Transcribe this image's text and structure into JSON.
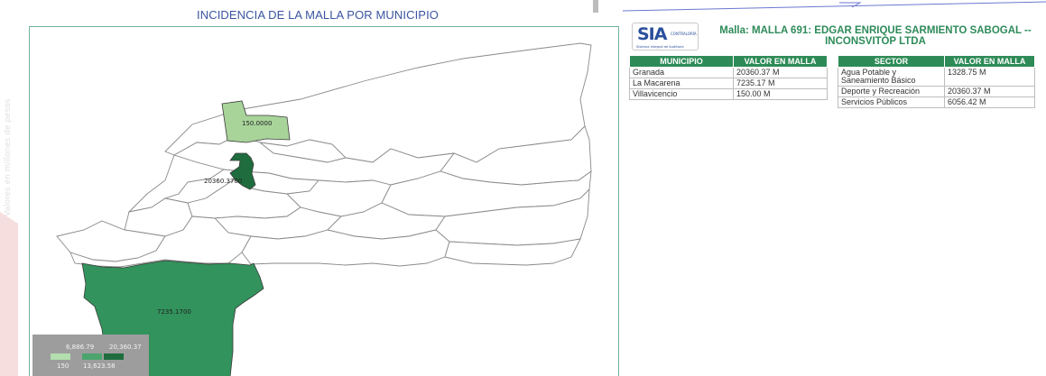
{
  "side_label": "Valores en millones de pesos",
  "map": {
    "title": "INCIDENCIA DE LA MALLA POR MUNICIPIO",
    "labels": {
      "villavicencio": "150.0000",
      "granada": "20360.3700",
      "la_macarena": "7235.1700"
    },
    "colors": {
      "villavicencio": "#a8d49a",
      "granada": "#1f6d3e",
      "la_macarena": "#32935c",
      "background_region": "#ffffff",
      "border": "#8a8a8a"
    },
    "legend": {
      "top_left": "6,886.79",
      "top_right": "20,360.37",
      "bottom_left": "150",
      "bottom_right": "13,623.58",
      "swatches": [
        "#b3deae",
        "#4ca56e",
        "#1f6d3e"
      ]
    }
  },
  "header": {
    "logo_text": "SIA",
    "logo_subtext": "CONTRALORÍA",
    "logo_tag": "Sistema Integral de Auditoría",
    "malla_title": "Malla:  MALLA 691:  EDGAR ENRIQUE SARMIENTO SABOGAL -- INCONSVITOP LTDA"
  },
  "municipio_table": {
    "headers": [
      "MUNICIPIO",
      "VALOR EN MALLA"
    ],
    "rows": [
      [
        "Granada",
        "20360.37 M"
      ],
      [
        "La Macarena",
        "7235.17 M"
      ],
      [
        "Villavicencio",
        "150.00 M"
      ]
    ]
  },
  "sector_table": {
    "headers": [
      "SECTOR",
      "VALOR EN MALLA"
    ],
    "rows": [
      [
        "Agua Potable y Saneamiento Básico",
        "1328.75 M"
      ],
      [
        "Deporte y Recreación",
        "20360.37 M"
      ],
      [
        "Servicios Públicos",
        "6056.42 M"
      ]
    ]
  }
}
